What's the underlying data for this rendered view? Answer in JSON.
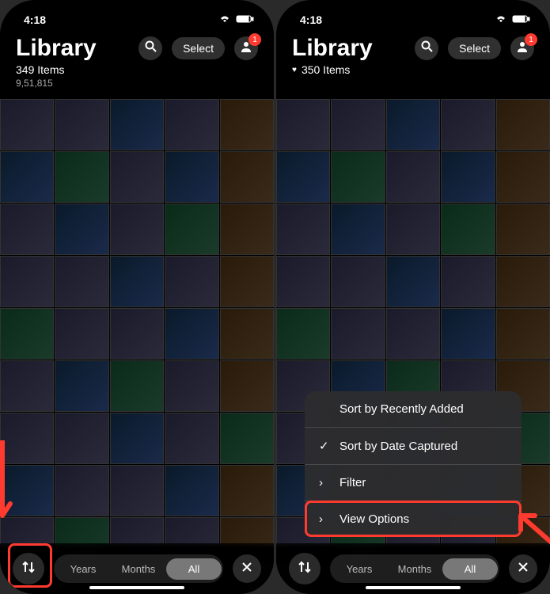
{
  "left": {
    "time": "4:18",
    "title": "Library",
    "item_count": "349 Items",
    "sub_number": "9,51,815",
    "select_label": "Select",
    "badge": "1",
    "segments": {
      "years": "Years",
      "months": "Months",
      "all": "All"
    }
  },
  "right": {
    "time": "4:18",
    "title": "Library",
    "item_count": "350 Items",
    "select_label": "Select",
    "badge": "1",
    "segments": {
      "years": "Years",
      "months": "Months",
      "all": "All"
    },
    "popup": {
      "sort_recent": "Sort by Recently Added",
      "sort_date": "Sort by Date Captured",
      "filter": "Filter",
      "view_options": "View Options"
    }
  }
}
